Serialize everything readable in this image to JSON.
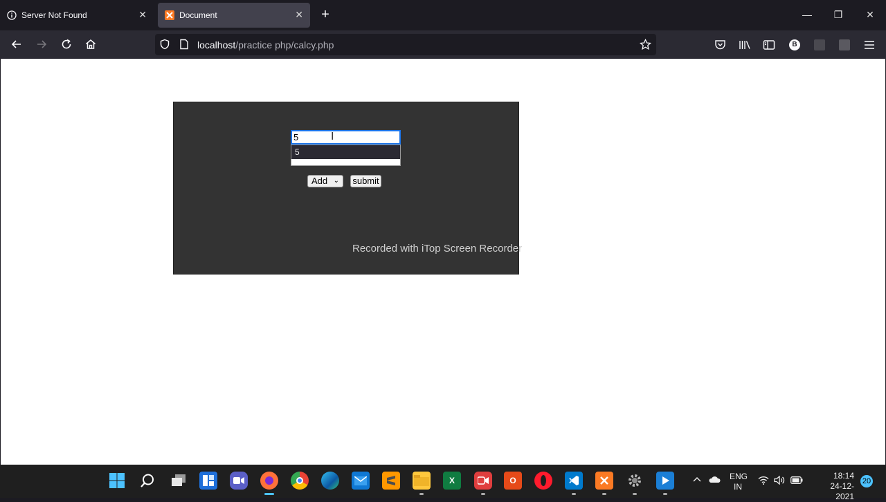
{
  "browser": {
    "tabs": [
      {
        "label": "Server Not Found",
        "icon": "info-icon",
        "active": false
      },
      {
        "label": "Document",
        "icon": "xampp-icon",
        "active": true
      }
    ],
    "url_host": "localhost",
    "url_path": "/practice php/calcy.php",
    "profile_badge": "B"
  },
  "calculator": {
    "input_value": "5",
    "autocomplete_suggestion": "5",
    "operator_selected": "Add",
    "submit_label": "submit"
  },
  "watermark": "Recorded with iTop Screen Recorder",
  "taskbar": {
    "apps": [
      "start",
      "search",
      "task-view",
      "widgets",
      "teams",
      "firefox",
      "chrome",
      "edge",
      "mail",
      "sublime",
      "files",
      "excel",
      "itop-recorder",
      "office",
      "opera",
      "vscode",
      "xampp",
      "settings",
      "media"
    ],
    "language": "ENG",
    "region": "IN",
    "time": "18:14",
    "date": "24-12-2021",
    "notifications": "20"
  },
  "colors": {
    "accent": "#4cc2ff",
    "panel": "#333333",
    "input_focus": "#1a73e8"
  }
}
